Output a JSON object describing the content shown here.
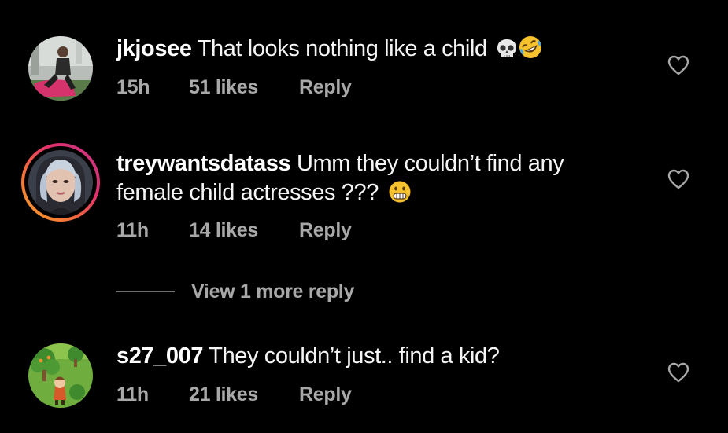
{
  "comments": [
    {
      "username": "jkjosee",
      "text": "That looks nothing like a child",
      "emojis": [
        "skull-emoji",
        "rolling-laughing-emoji"
      ],
      "time": "15h",
      "likes": "51 likes",
      "reply": "Reply",
      "has_story": false
    },
    {
      "username": "treywantsdatass",
      "text": "Umm they couldn’t find any female child actresses ???",
      "emojis": [
        "grimacing-emoji"
      ],
      "time": "11h",
      "likes": "14 likes",
      "reply": "Reply",
      "has_story": true
    },
    {
      "username": "s27_007",
      "text": "They couldn’t just.. find a kid?",
      "emojis": [],
      "time": "11h",
      "likes": "21 likes",
      "reply": "Reply",
      "has_story": false
    }
  ],
  "view_more_replies": "View 1 more reply",
  "colors": {
    "background": "#000000",
    "primary_text": "#f5f5f5",
    "secondary_text": "#a8a8a8",
    "story_ring_start": "#f9a428",
    "story_ring_end": "#c13584"
  }
}
